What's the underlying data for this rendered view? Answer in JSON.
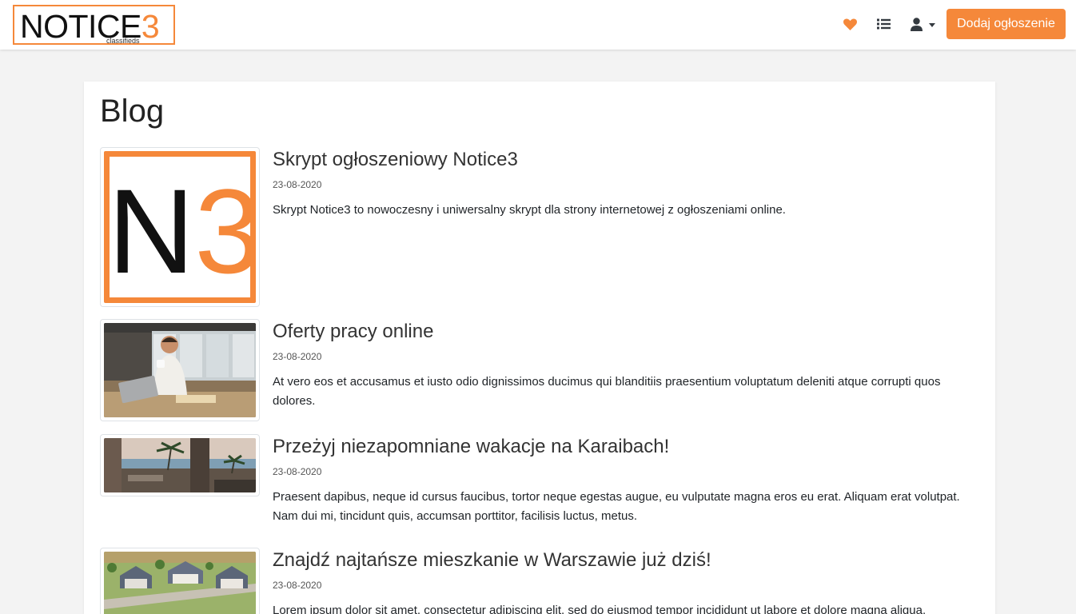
{
  "brand": {
    "logo_main": "NOTICE",
    "logo_number": "3",
    "logo_sub": "classifieds",
    "accent_color": "#f5883a"
  },
  "nav": {
    "favorites_icon": "heart-icon",
    "list_icon": "list-icon",
    "user_icon": "user-icon",
    "add_button_label": "Dodaj ogłoszenie"
  },
  "main": {
    "title": "Blog",
    "posts": [
      {
        "title": "Skrypt ogłoszeniowy Notice3",
        "date": "23-08-2020",
        "excerpt": "Skrypt Notice3 to nowoczesny i uniwersalny skrypt dla strony internetowej z ogłoszeniami online.",
        "image": "notice3-logo",
        "image_text": "N3"
      },
      {
        "title": "Oferty pracy online",
        "date": "23-08-2020",
        "excerpt": "At vero eos et accusamus et iusto odio dignissimos ducimus qui blanditiis praesentium voluptatum deleniti atque corrupti quos dolores.",
        "image": "man-with-laptop-photo"
      },
      {
        "title": "Przeżyj niezapomniane wakacje na Karaibach!",
        "date": "23-08-2020",
        "excerpt": "Praesent dapibus, neque id cursus faucibus, tortor neque egestas augue, eu vulputate magna eros eu erat. Aliquam erat volutpat. Nam dui mi, tincidunt quis, accumsan porttitor, facilisis luctus, metus.",
        "image": "beach-terrace-photo"
      },
      {
        "title": "Znajdź najtańsze mieszkanie w Warszawie już dziś!",
        "date": "23-08-2020",
        "excerpt": "Lorem ipsum dolor sit amet, consectetur adipiscing elit, sed do eiusmod tempor incididunt ut labore et dolore magna aliqua.",
        "image": "houses-aerial-photo"
      }
    ]
  }
}
